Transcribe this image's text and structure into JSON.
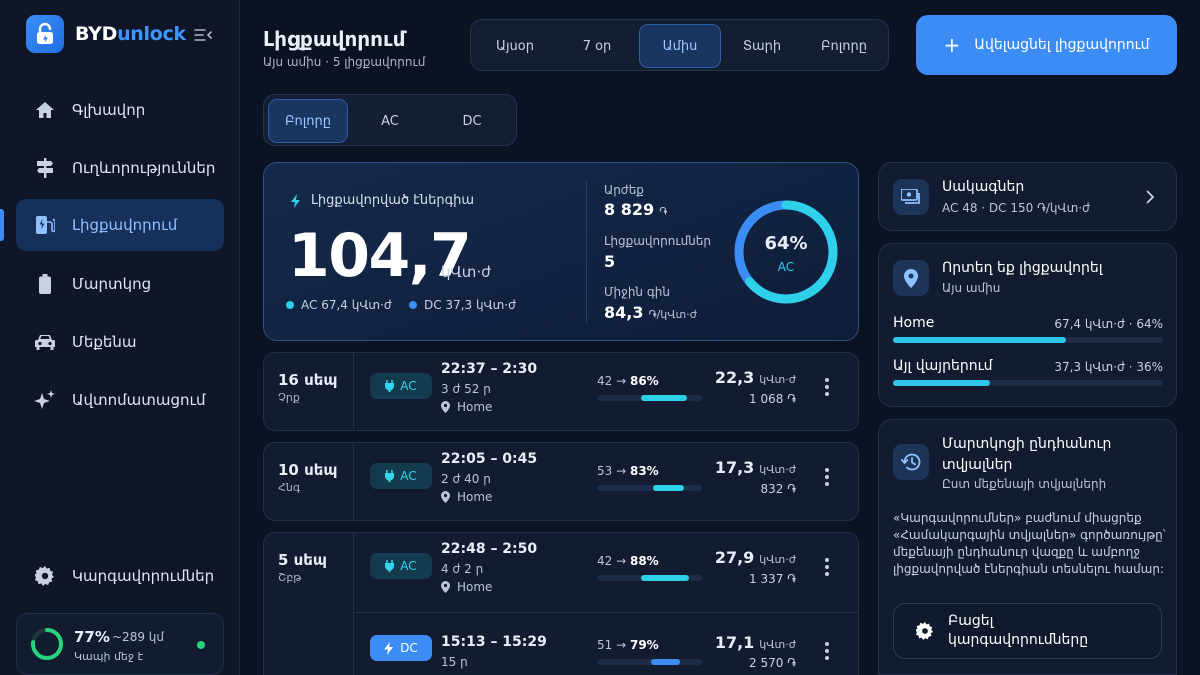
{
  "app": {
    "logo_part1": "BYD",
    "logo_part2": "unlock"
  },
  "nav": [
    {
      "label": "Գլխավոր",
      "icon": "home-icon"
    },
    {
      "label": "Ուղևորություններ",
      "icon": "signpost-icon"
    },
    {
      "label": "Լիցքավորում",
      "icon": "ev-charger-icon",
      "active": true
    },
    {
      "label": "Մարտկոց",
      "icon": "battery-icon"
    },
    {
      "label": "Մեքենա",
      "icon": "car-icon"
    },
    {
      "label": "Ավտոմատացում",
      "icon": "sparkles-icon"
    }
  ],
  "nav_settings": {
    "label": "Կարգավորումներ",
    "icon": "gear-icon"
  },
  "battery": {
    "percent_text": "77%",
    "level": 0.77,
    "range": "~289 կմ",
    "status": "Կապի մեջ է",
    "status_color": "#27d37b"
  },
  "header": {
    "title": "Լիցքավորում",
    "subtitle": "Այս ամիս · 5 լիցքավորում"
  },
  "period_tabs": [
    {
      "label": "Այսօր"
    },
    {
      "label": "7 օր"
    },
    {
      "label": "Ամիս",
      "active": true
    },
    {
      "label": "Տարի"
    },
    {
      "label": "Բոլորը"
    }
  ],
  "add_button": {
    "label": "Ավելացնել լիցքավորում"
  },
  "type_tabs": [
    {
      "label": "Բոլորը",
      "active": true
    },
    {
      "label": "AC"
    },
    {
      "label": "DC"
    }
  ],
  "summary": {
    "label": "Լիցքավորված էներգիա",
    "value": "104,7",
    "unit": "կՎտ·ժ",
    "legend_ac": "AC 67,4 կՎտ·ժ",
    "legend_dc": "DC 37,3 կՎտ·ժ",
    "cost_label": "Արժեք",
    "cost_value": "8 829",
    "cost_unit": "֏",
    "sessions_label": "Լիցքավորումներ",
    "sessions_value": "5",
    "avg_label": "Միջին գին",
    "avg_value": "84,3",
    "avg_unit": "֏/կՎտ·ժ",
    "donut_pct_text": "64%",
    "donut_fraction": 0.64,
    "donut_label": "AC"
  },
  "colors": {
    "accent": "#3b8df5",
    "ac": "#2ed0ea",
    "dc": "#3b8df5"
  },
  "sessions": [
    {
      "date": "16 սեպ",
      "weekday": "Չրք",
      "rows": [
        {
          "type": "AC",
          "time": "22:37 – 2:30",
          "duration": "3 ժ 52 ր",
          "location": "Home",
          "soc_from": "42",
          "soc_to": "86%",
          "soc_from_n": 42,
          "soc_to_n": 86,
          "energy": "22,3",
          "energy_unit": "կՎտ·ժ",
          "cost": "1 068 ֏"
        }
      ]
    },
    {
      "date": "10 սեպ",
      "weekday": "Հնգ",
      "rows": [
        {
          "type": "AC",
          "time": "22:05 – 0:45",
          "duration": "2 ժ 40 ր",
          "location": "Home",
          "soc_from": "53",
          "soc_to": "83%",
          "soc_from_n": 53,
          "soc_to_n": 83,
          "energy": "17,3",
          "energy_unit": "կՎտ·ժ",
          "cost": "832 ֏"
        }
      ]
    },
    {
      "date": "5 սեպ",
      "weekday": "Շբթ",
      "rows": [
        {
          "type": "AC",
          "time": "22:48 – 2:50",
          "duration": "4 ժ 2 ր",
          "location": "Home",
          "soc_from": "42",
          "soc_to": "88%",
          "soc_from_n": 42,
          "soc_to_n": 88,
          "energy": "27,9",
          "energy_unit": "կՎտ·ժ",
          "cost": "1 337 ֏"
        },
        {
          "type": "DC",
          "time": "15:13 – 15:29",
          "duration": "15 ր",
          "location": "",
          "soc_from": "51",
          "soc_to": "79%",
          "soc_from_n": 51,
          "soc_to_n": 79,
          "energy": "17,1",
          "energy_unit": "կՎտ·ժ",
          "cost": "2 570 ֏"
        }
      ]
    }
  ],
  "tariffs": {
    "title": "Սակագներ",
    "subtitle": "AC 48 · DC 150 ֏/կՎտ·ժ"
  },
  "where": {
    "title": "Որտեղ եք լիցքավորել",
    "subtitle": "Այս ամիս",
    "rows": [
      {
        "label": "Home",
        "value": "67,4 կՎտ·ժ · 64%",
        "fraction": 0.64
      },
      {
        "label": "Այլ վայրերում",
        "value": "37,3 կՎտ·ժ · 36%",
        "fraction": 0.36
      }
    ]
  },
  "history": {
    "title_line1": "Մարտկոցի ընդհանուր",
    "title_line2": "տվյալներ",
    "subtitle": "Ըստ մեքենայի տվյալների",
    "text": "«Կարգավորումներ» բաժնում միացրեք «Համակարգային տվյալներ» գործառույթը՝ մեքենայի ընդհանուր վազքը և ամբողջ լիցքավորված էներգիան տեսնելու համար:",
    "button_line1": "Բացել",
    "button_line2": "կարգավորումները"
  }
}
